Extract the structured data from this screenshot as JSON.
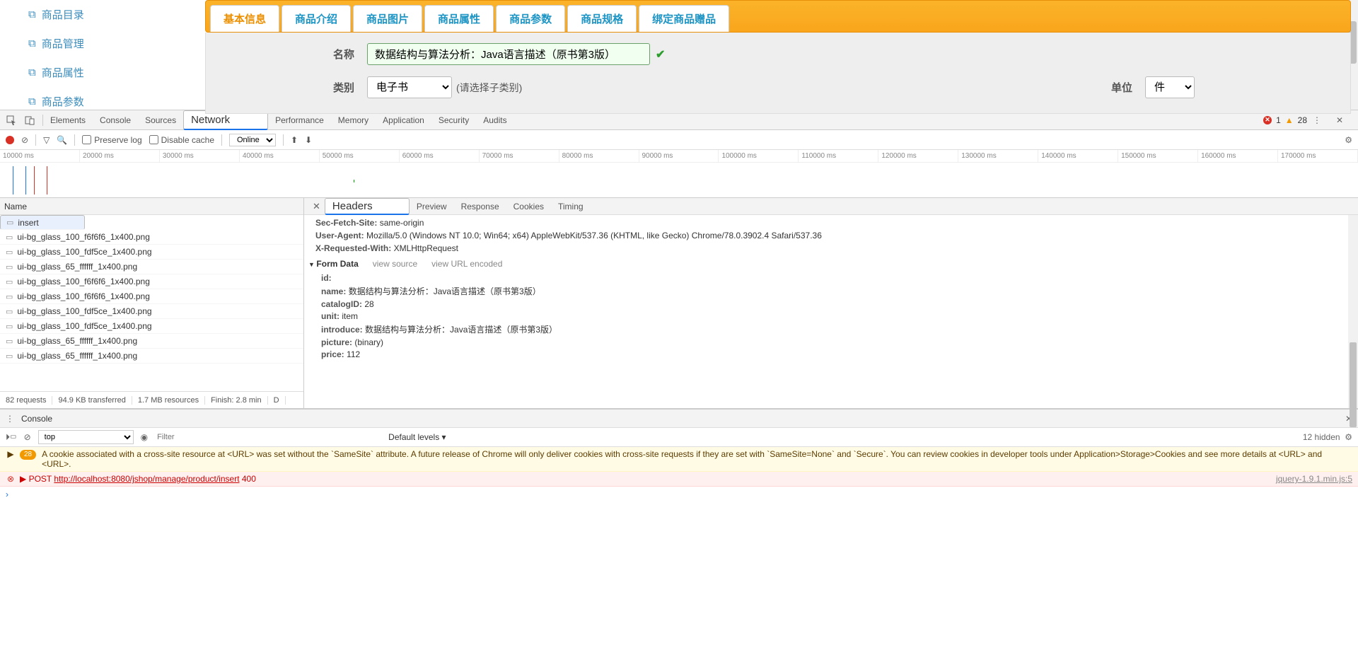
{
  "sidebar": {
    "items": [
      {
        "label": "商品目录"
      },
      {
        "label": "商品管理"
      },
      {
        "label": "商品属性"
      },
      {
        "label": "商品参数"
      }
    ]
  },
  "tabs": [
    "基本信息",
    "商品介绍",
    "商品图片",
    "商品属性",
    "商品参数",
    "商品规格",
    "绑定商品赠品"
  ],
  "form": {
    "name_label": "名称",
    "name_value": "数据结构与算法分析：Java语言描述（原书第3版）",
    "cat_label": "类别",
    "cat_value": "电子书",
    "cat_hint": "(请选择子类别)",
    "unit_label": "单位",
    "unit_value": "件"
  },
  "devtools": {
    "tabs": [
      "Elements",
      "Console",
      "Sources",
      "Network",
      "Performance",
      "Memory",
      "Application",
      "Security",
      "Audits"
    ],
    "errors": "1",
    "warnings": "28",
    "preserve": "Preserve log",
    "disable": "Disable cache",
    "online": "Online",
    "ruler": [
      "10000 ms",
      "20000 ms",
      "30000 ms",
      "40000 ms",
      "50000 ms",
      "60000 ms",
      "70000 ms",
      "80000 ms",
      "90000 ms",
      "100000 ms",
      "110000 ms",
      "120000 ms",
      "130000 ms",
      "140000 ms",
      "150000 ms",
      "160000 ms",
      "170000 ms"
    ],
    "name_col": "Name",
    "requests": [
      "insert",
      "ui-bg_glass_100_f6f6f6_1x400.png",
      "ui-bg_glass_100_fdf5ce_1x400.png",
      "ui-bg_glass_65_ffffff_1x400.png",
      "ui-bg_glass_100_f6f6f6_1x400.png",
      "ui-bg_glass_100_f6f6f6_1x400.png",
      "ui-bg_glass_100_fdf5ce_1x400.png",
      "ui-bg_glass_100_fdf5ce_1x400.png",
      "ui-bg_glass_65_ffffff_1x400.png",
      "ui-bg_glass_65_ffffff_1x400.png"
    ],
    "footer": {
      "reqs": "82 requests",
      "transferred": "94.9 KB transferred",
      "resources": "1.7 MB resources",
      "finish": "Finish: 2.8 min",
      "dom": "D"
    },
    "detail_tabs": [
      "Headers",
      "Preview",
      "Response",
      "Cookies",
      "Timing"
    ],
    "headers": [
      {
        "k": "Sec-Fetch-Site:",
        "v": "same-origin"
      },
      {
        "k": "User-Agent:",
        "v": "Mozilla/5.0 (Windows NT 10.0; Win64; x64) AppleWebKit/537.36 (KHTML, like Gecko) Chrome/78.0.3902.4 Safari/537.36"
      },
      {
        "k": "X-Requested-With:",
        "v": "XMLHttpRequest"
      }
    ],
    "formdata_title": "Form Data",
    "view_source": "view source",
    "view_url": "view URL encoded",
    "formdata": [
      {
        "k": "id:",
        "v": ""
      },
      {
        "k": "name:",
        "v": "数据结构与算法分析：Java语言描述（原书第3版）"
      },
      {
        "k": "catalogID:",
        "v": "28"
      },
      {
        "k": "unit:",
        "v": "item"
      },
      {
        "k": "introduce:",
        "v": "数据结构与算法分析：Java语言描述（原书第3版）"
      },
      {
        "k": "picture:",
        "v": "(binary)"
      },
      {
        "k": "price:",
        "v": "112"
      }
    ]
  },
  "console": {
    "tab": "Console",
    "ctx": "top",
    "filter_ph": "Filter",
    "levels": "Default levels ▾",
    "hidden": "12 hidden",
    "warn_badge": "28",
    "warn_msg": "A cookie associated with a cross-site resource at <URL> was set without the `SameSite` attribute. A future release of Chrome will only deliver cookies with cross-site requests if they are set with `SameSite=None` and `Secure`. You can review cookies in developer tools under Application>Storage>Cookies and see more details at <URL> and <URL>.",
    "err_prefix": "▶ POST ",
    "err_url": "http://localhost:8080/jshop/manage/product/insert",
    "err_code": " 400",
    "err_src": "jquery-1.9.1.min.js:5"
  }
}
